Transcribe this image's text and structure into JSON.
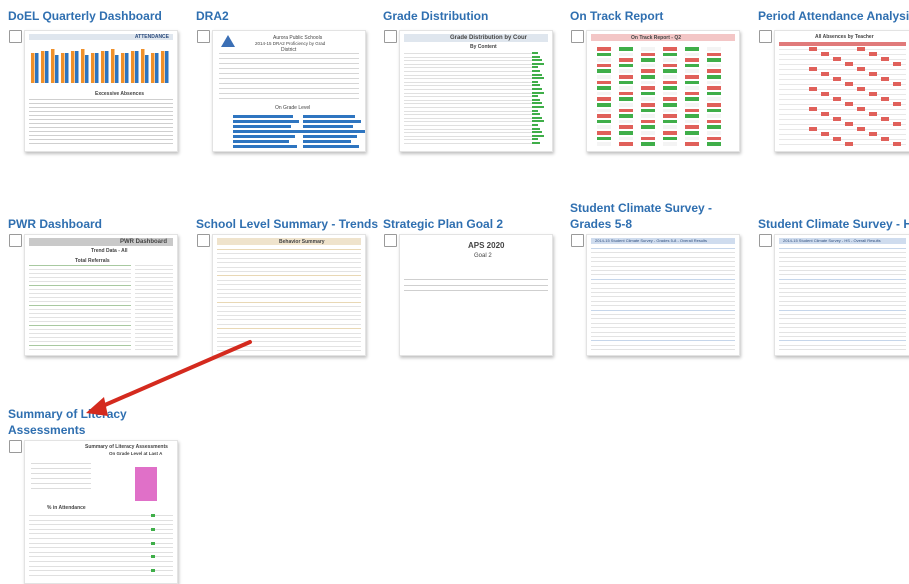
{
  "reports": [
    {
      "title": "DoEL Quarterly Dashboard",
      "thumb_heading": "ATTENDANCE",
      "thumb_subheading": "Excessive Absences"
    },
    {
      "title": "DRA2",
      "thumb_heading": "Aurora Public Schools",
      "thumb_subheading": "2014-15 DRA2 Proficiency by Grad",
      "thumb_extra": "District",
      "thumb_extra2": "On Grade Level"
    },
    {
      "title": "Grade Distribution",
      "thumb_heading": "Grade Distribution by Cour",
      "thumb_subheading": "By Content"
    },
    {
      "title": "On Track Report",
      "thumb_heading": "On Track Report - Q2"
    },
    {
      "title": "Period Attendance Analysis",
      "thumb_heading": "All Absences by Teacher"
    },
    {
      "title": "PWR Dashboard",
      "thumb_heading": "PWR Dashboard",
      "thumb_subheading": "Trend Data - All",
      "thumb_extra": "Total Referrals"
    },
    {
      "title": "School Level Summary - Trends",
      "thumb_heading": "Behavior Summary"
    },
    {
      "title": "Strategic Plan Goal 2",
      "thumb_heading": "APS 2020",
      "thumb_subheading": "Goal 2"
    },
    {
      "title": "Student Climate Survey - Grades 5-8",
      "thumb_heading": "2014-15 Student Climate Survey - Grades 5-8 - Overall Results"
    },
    {
      "title": "Student Climate Survey - HS",
      "thumb_heading": "2014-15 Student Climate Survey - HS - Overall Results"
    },
    {
      "title": "Summary of Literacy Assessments",
      "thumb_heading": "Summary of Literacy Assessments",
      "thumb_subheading": "On Grade Level at Last A",
      "thumb_extra": "% in Attendance"
    }
  ],
  "colors": {
    "link": "#2f6fb0",
    "arrow": "#d42a1e",
    "bar_orange": "#f0902a",
    "bar_blue": "#2e75c0",
    "green": "#3fae49",
    "red": "#e0605a",
    "pink": "#e070c8"
  }
}
